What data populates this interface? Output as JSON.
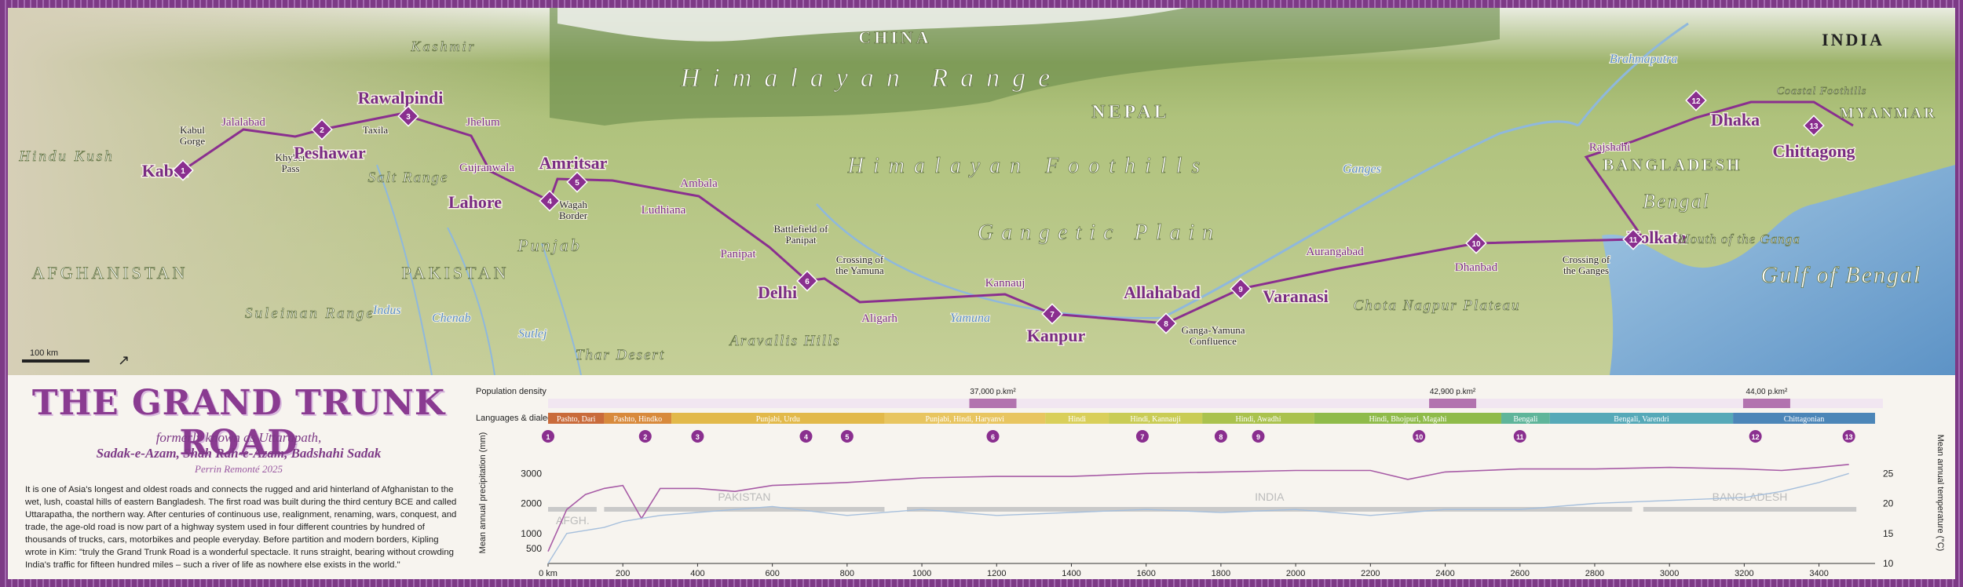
{
  "title": "THE GRAND TRUNK ROAD",
  "subtitle_line1": "formerly known as Uttarapath,",
  "subtitle_line2": "Sadak-e-Azam, Shah Rah-e-Azam, Badshahi Sadak",
  "author": "Perrin Remonté 2025",
  "description": "It is one of Asia's longest and oldest roads and connects the rugged and arid hinterland of Afghanistan to the wet, lush, coastal hills of eastern Bangladesh. The first road was built during the third century BCE and called Uttarapatha, the northern way. After centuries of continuous use, realignment, renaming, wars, conquest, and trade, the age-old road is now part of a highway system used in four different countries by hundred of thousands of trucks, cars, motorbikes and people everyday. Before partition and modern borders, Kipling wrote in Kim: \"truly the Grand Trunk Road is a wonderful spectacle. It runs straight, bearing without crowding India's traffic for fifteen hundred miles – such a river of life as nowhere else exists in the world.\"",
  "map": {
    "scale_bar": "100 km",
    "countries": [
      "AFGHANISTAN",
      "PAKISTAN",
      "CHINA",
      "NEPAL",
      "INDIA",
      "BANGLADESH",
      "MYANMAR"
    ],
    "regions": [
      "Kashmir",
      "Hindu Kush",
      "Salt Range",
      "Punjab",
      "Suleiman Range",
      "Thar Desert",
      "Aravallis Hills",
      "Himalayan Range",
      "Himalayan Foothills",
      "Gangetic Plain",
      "Chota Nagpur Plateau",
      "Bengal",
      "Coastal Foothills",
      "Mouth of the Ganga",
      "Gulf of Bengal"
    ],
    "rivers": [
      "Indus",
      "Chenab",
      "Sutlej",
      "Yamuna",
      "Ganges",
      "Brahmaputra"
    ],
    "cities": [
      {
        "name": "Kabul",
        "type": "major"
      },
      {
        "name": "Kabul Gorge",
        "type": "minor"
      },
      {
        "name": "Jalalabad",
        "type": "medium"
      },
      {
        "name": "Khyber Pass",
        "type": "minor"
      },
      {
        "name": "Peshawar",
        "type": "major"
      },
      {
        "name": "Taxila",
        "type": "minor"
      },
      {
        "name": "Rawalpindi",
        "type": "major"
      },
      {
        "name": "Jhelum",
        "type": "medium"
      },
      {
        "name": "Gujranwala",
        "type": "medium"
      },
      {
        "name": "Lahore",
        "type": "major"
      },
      {
        "name": "Wagah Border",
        "type": "minor"
      },
      {
        "name": "Amritsar",
        "type": "major"
      },
      {
        "name": "Ludhiana",
        "type": "medium"
      },
      {
        "name": "Ambala",
        "type": "medium"
      },
      {
        "name": "Battlefield of Panipat",
        "type": "minor"
      },
      {
        "name": "Panipat",
        "type": "medium"
      },
      {
        "name": "Delhi",
        "type": "major"
      },
      {
        "name": "Crossing of the Yamuna",
        "type": "minor"
      },
      {
        "name": "Aligarh",
        "type": "medium"
      },
      {
        "name": "Kannauj",
        "type": "medium"
      },
      {
        "name": "Kanpur",
        "type": "major"
      },
      {
        "name": "Allahabad",
        "type": "major"
      },
      {
        "name": "Ganga-Yamuna Confluence",
        "type": "minor"
      },
      {
        "name": "Varanasi",
        "type": "major"
      },
      {
        "name": "Aurangabad",
        "type": "medium"
      },
      {
        "name": "Dhanbad",
        "type": "medium"
      },
      {
        "name": "Crossing of the Ganges",
        "type": "minor"
      },
      {
        "name": "Kolkata",
        "type": "major"
      },
      {
        "name": "Rajshahi",
        "type": "medium"
      },
      {
        "name": "Dhaka",
        "type": "major"
      },
      {
        "name": "Chittagong",
        "type": "major"
      }
    ],
    "stages": [
      "1",
      "2",
      "3",
      "4",
      "5",
      "6",
      "7",
      "8",
      "9",
      "10",
      "11",
      "12",
      "13"
    ]
  },
  "profile": {
    "population_label": "Population density",
    "population_peaks": [
      "37,000 p.km²",
      "42,900 p.km²",
      "44,00 p.km²"
    ],
    "languages_label": "Languages & dialects",
    "languages": [
      {
        "label": "Pashto, Dari",
        "color": "#c96b3b"
      },
      {
        "label": "Pashto, Hindko",
        "color": "#d88a3c"
      },
      {
        "label": "Punjabi, Urdu",
        "color": "#e2b94a"
      },
      {
        "label": "Punjabi, Hindi, Haryanvi",
        "color": "#e8c560"
      },
      {
        "label": "Hindi",
        "color": "#d9cf5a"
      },
      {
        "label": "Hindi, Kannauji",
        "color": "#c9cc55"
      },
      {
        "label": "Hindi, Awadhi",
        "color": "#aac24e"
      },
      {
        "label": "Hindi, Bhojpuri, Magahi",
        "color": "#8fbb4a"
      },
      {
        "label": "Bengali",
        "color": "#5fb59a"
      },
      {
        "label": "Bengali, Varendri",
        "color": "#56a9b8"
      },
      {
        "label": "Chittagonian",
        "color": "#4c86b8"
      }
    ],
    "left_axis_label": "Mean annual precipitation (mm)",
    "right_axis_label": "Mean annual temperature (°C)",
    "country_bars": [
      "AFGH.",
      "PAKISTAN",
      "INDIA",
      "BANGLADESH"
    ],
    "x_ticks": [
      "0 km",
      "200",
      "400",
      "600",
      "800",
      "1000",
      "1200",
      "1400",
      "1600",
      "1800",
      "2000",
      "2200",
      "2400",
      "2600",
      "2800",
      "3000",
      "3200",
      "3400"
    ],
    "left_ticks": [
      "500",
      "1000",
      "2000",
      "3000"
    ],
    "right_ticks": [
      "10",
      "15",
      "20",
      "25"
    ]
  },
  "colors": {
    "route": "#8a2f8f",
    "accent": "#7d3a86",
    "water": "#8fb8dc",
    "plain": "#b7c98a"
  },
  "chart_data": {
    "type": "line",
    "x": [
      0,
      50,
      100,
      150,
      200,
      250,
      300,
      400,
      500,
      600,
      800,
      1000,
      1200,
      1400,
      1600,
      1800,
      2000,
      2200,
      2300,
      2400,
      2600,
      2800,
      3000,
      3200,
      3300,
      3400,
      3480
    ],
    "series": [
      {
        "values": [
          400,
          1800,
          2300,
          2500,
          2600,
          1500,
          2500,
          2500,
          2400,
          2600,
          2700,
          2850,
          2900,
          2900,
          3000,
          3050,
          3100,
          3100,
          2800,
          3050,
          3150,
          3150,
          3200,
          3150,
          3100,
          3200,
          3300
        ]
      },
      {
        "values": [
          10,
          15,
          15.5,
          16,
          17,
          17.5,
          18,
          18.5,
          19,
          19.5,
          18,
          19,
          18,
          18.5,
          19,
          18.5,
          19,
          18,
          18.5,
          19,
          19,
          20,
          20.5,
          21,
          22,
          23.5,
          25
        ]
      }
    ],
    "xlabel": "",
    "left_ylim": [
      0,
      3400
    ],
    "right_ylim": [
      10,
      27
    ]
  }
}
